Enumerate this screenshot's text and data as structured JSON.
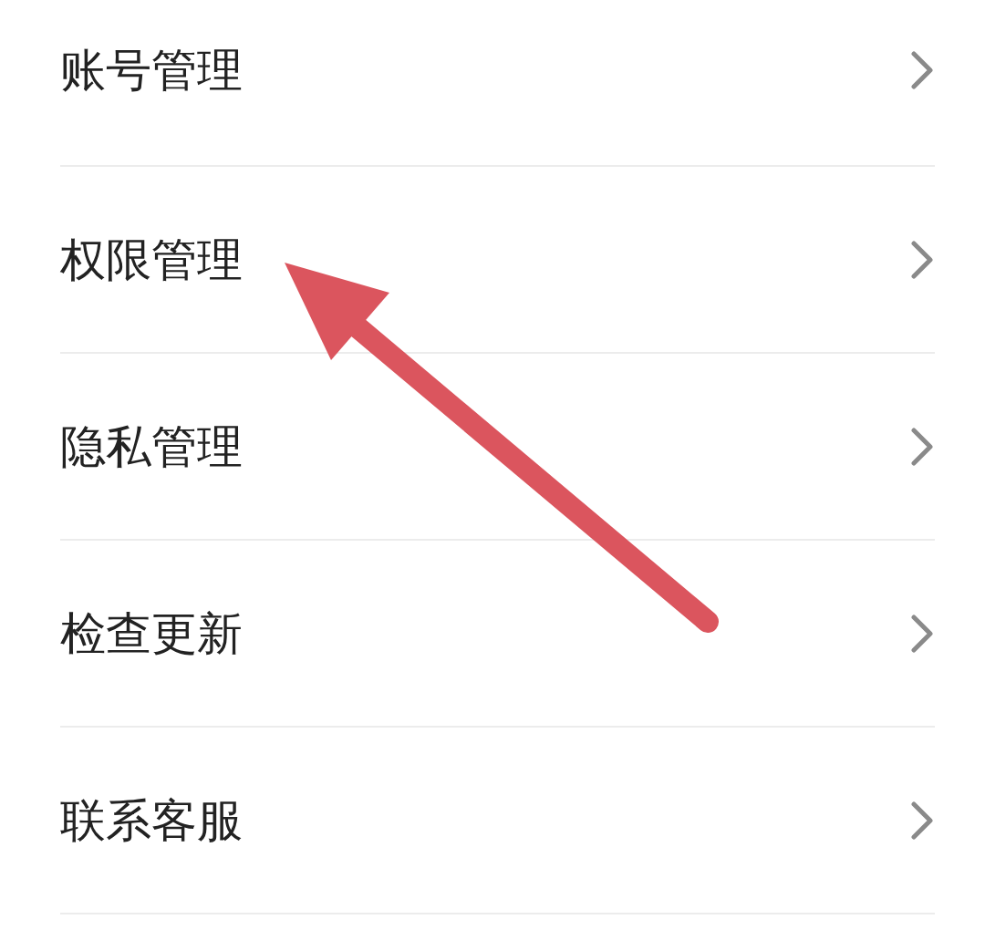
{
  "menu": {
    "items": [
      {
        "label": "账号管理"
      },
      {
        "label": "权限管理"
      },
      {
        "label": "隐私管理"
      },
      {
        "label": "检查更新"
      },
      {
        "label": "联系客服"
      }
    ]
  }
}
